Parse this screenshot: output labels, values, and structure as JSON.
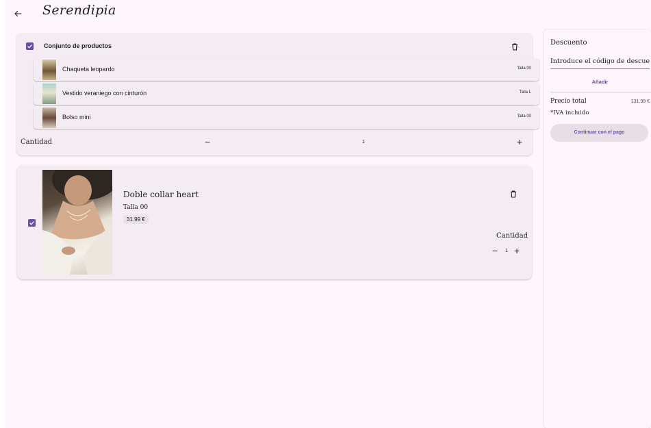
{
  "header": {
    "back_icon": "arrow-left-icon",
    "logo_text": "Serendipia"
  },
  "bundle": {
    "title": "Conjunto de productos",
    "checked": true,
    "items": [
      {
        "name": "Chaqueta leopardo",
        "size": "Talla 00",
        "thumb_color": "#b59a6e"
      },
      {
        "name": "Vestido veraniego con cinturón",
        "size": "Talla L",
        "thumb_color": "#8fb0a4"
      },
      {
        "name": "Bolso mini",
        "size": "Talla 00",
        "thumb_color": "#8a6a55"
      }
    ],
    "quantity_label": "Cantidad",
    "quantity": "1",
    "minus": "−",
    "plus": "+"
  },
  "product": {
    "checked": true,
    "title": "Doble collar heart",
    "size": "Talla 00",
    "price": "31.99 €",
    "quantity_label": "Cantidad",
    "quantity": "1",
    "minus": "−",
    "plus": "+"
  },
  "summary": {
    "discount_label": "Descuento",
    "discount_placeholder": "Introduce el código de descue...",
    "add_button": "Añadir",
    "total_label": "Precio total",
    "total_value": "131.99 €",
    "tax_note": "*IVA incluido",
    "pay_button": "Continuar con el pago"
  },
  "colors": {
    "accent": "#6750a4",
    "background": "#fdf7fd",
    "card": "#f3edf3"
  }
}
